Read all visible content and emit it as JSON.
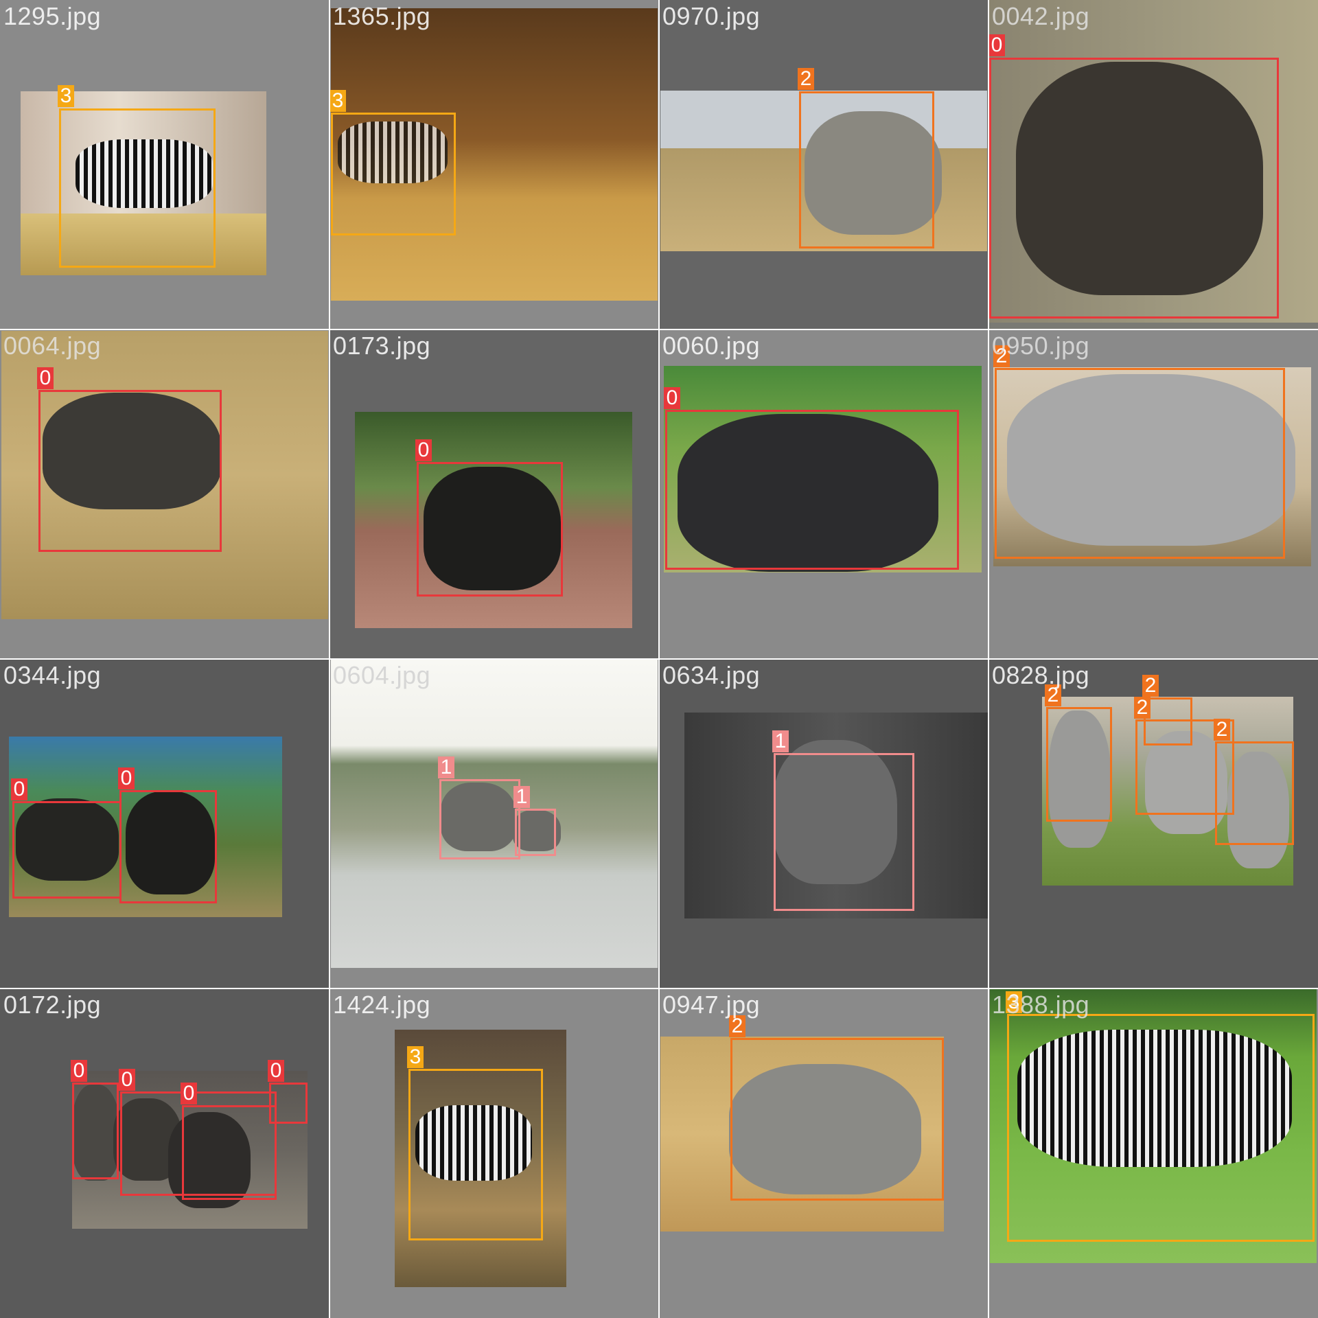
{
  "colors": {
    "class_0": "#e8383b",
    "class_1": "#f08c8c",
    "class_2": "#f0731e",
    "class_3": "#f5a815"
  },
  "tiles": [
    {
      "file": "1295.jpg",
      "labels": [
        "3"
      ]
    },
    {
      "file": "1365.jpg",
      "labels": [
        "3"
      ]
    },
    {
      "file": "0970.jpg",
      "labels": [
        "2"
      ]
    },
    {
      "file": "0042.jpg",
      "labels": [
        "0"
      ]
    },
    {
      "file": "0064.jpg",
      "labels": [
        "0"
      ]
    },
    {
      "file": "0173.jpg",
      "labels": [
        "0"
      ]
    },
    {
      "file": "0060.jpg",
      "labels": [
        "0"
      ]
    },
    {
      "file": "0950.jpg",
      "labels": [
        "2"
      ]
    },
    {
      "file": "0344.jpg",
      "labels": [
        "0",
        "0"
      ]
    },
    {
      "file": "0604.jpg",
      "labels": [
        "1",
        "1"
      ]
    },
    {
      "file": "0634.jpg",
      "labels": [
        "1"
      ]
    },
    {
      "file": "0828.jpg",
      "labels": [
        "2",
        "2",
        "2",
        "2"
      ]
    },
    {
      "file": "0172.jpg",
      "labels": [
        "0",
        "0",
        "0",
        "0"
      ]
    },
    {
      "file": "1424.jpg",
      "labels": [
        "3"
      ]
    },
    {
      "file": "0947.jpg",
      "labels": [
        "2"
      ]
    },
    {
      "file": "1388.jpg",
      "labels": [
        "3"
      ]
    }
  ]
}
